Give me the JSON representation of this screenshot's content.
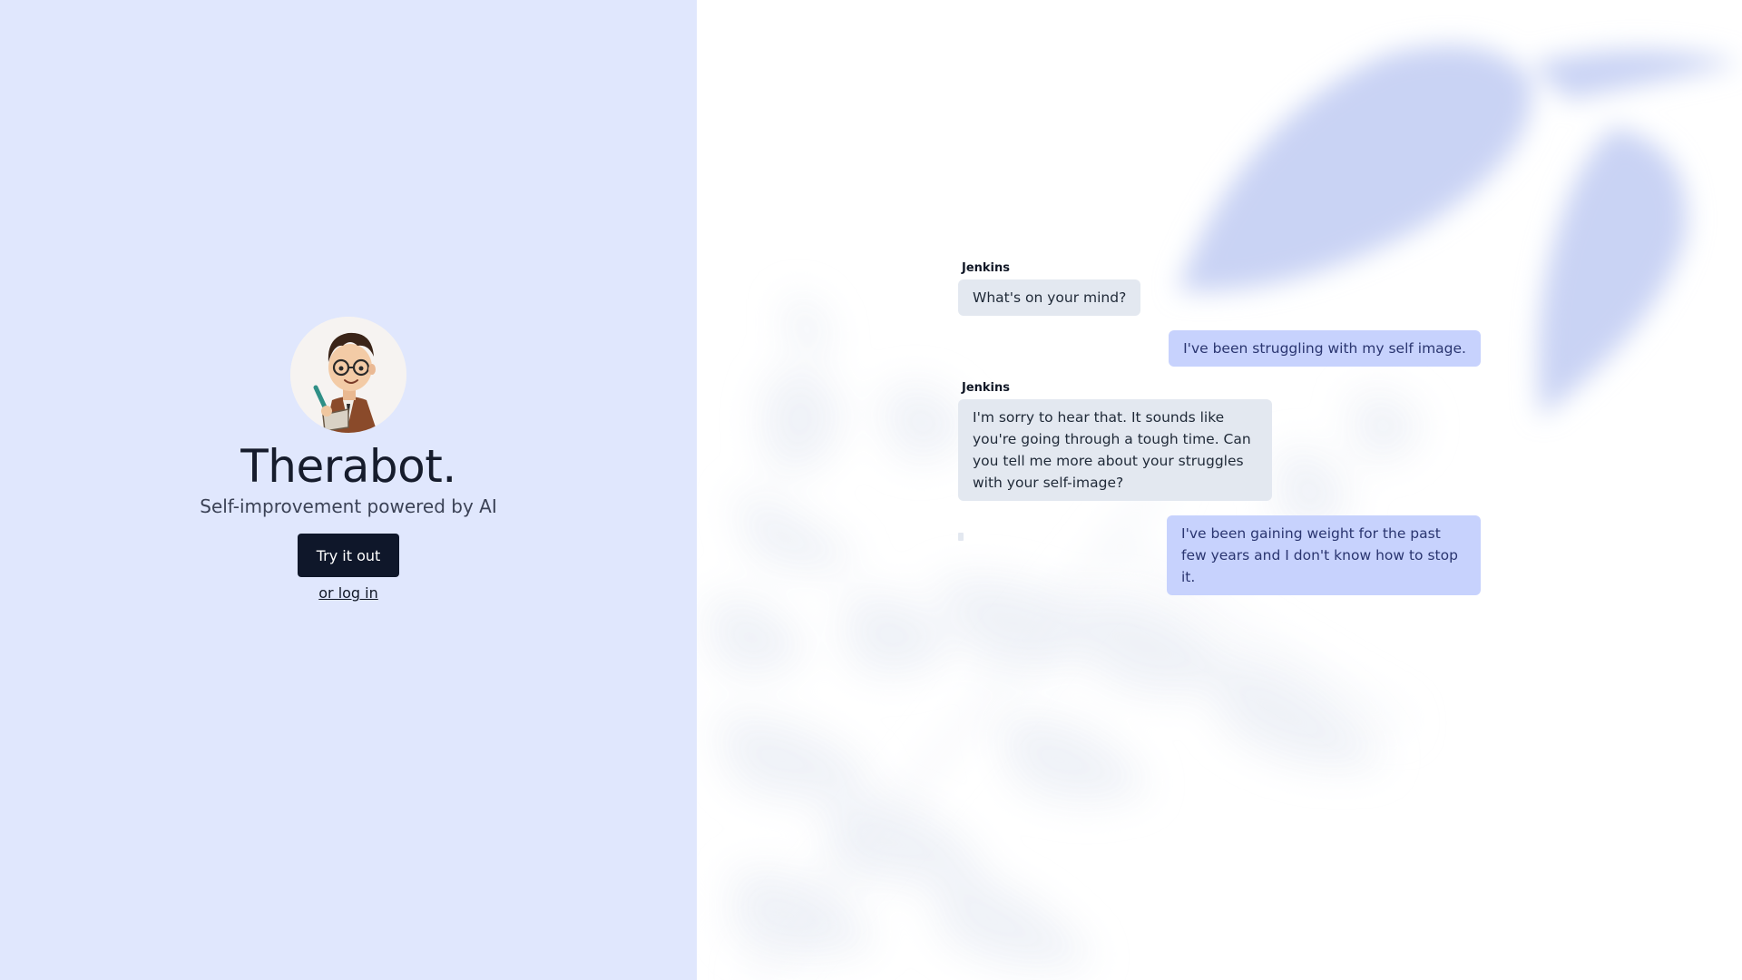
{
  "app": {
    "title": "Therabot.",
    "subtitle": "Self-improvement powered by AI",
    "try_button_label": "Try it out",
    "login_link_label": "or log in",
    "avatar_icon": "nerdy-mascot-avatar"
  },
  "chat": {
    "messages": [
      {
        "role": "bot",
        "sender": "Jenkins",
        "text": "What's on your mind?"
      },
      {
        "role": "user",
        "text": "I've been struggling with my self image."
      },
      {
        "role": "bot",
        "sender": "Jenkins",
        "text": "I'm sorry to hear that. It sounds like you're going through a tough time. Can you tell me more about your struggles with your self-image?"
      },
      {
        "role": "user",
        "text": "I've been gaining weight for the past few years and I don't know how to stop it."
      }
    ]
  },
  "colors": {
    "left_panel_bg": "#e0e7fd",
    "button_bg": "#0f172a",
    "bot_bubble": "#e3e8f0",
    "user_bubble": "#c7d2fd",
    "leaf_decor": "#c9d3f4"
  }
}
